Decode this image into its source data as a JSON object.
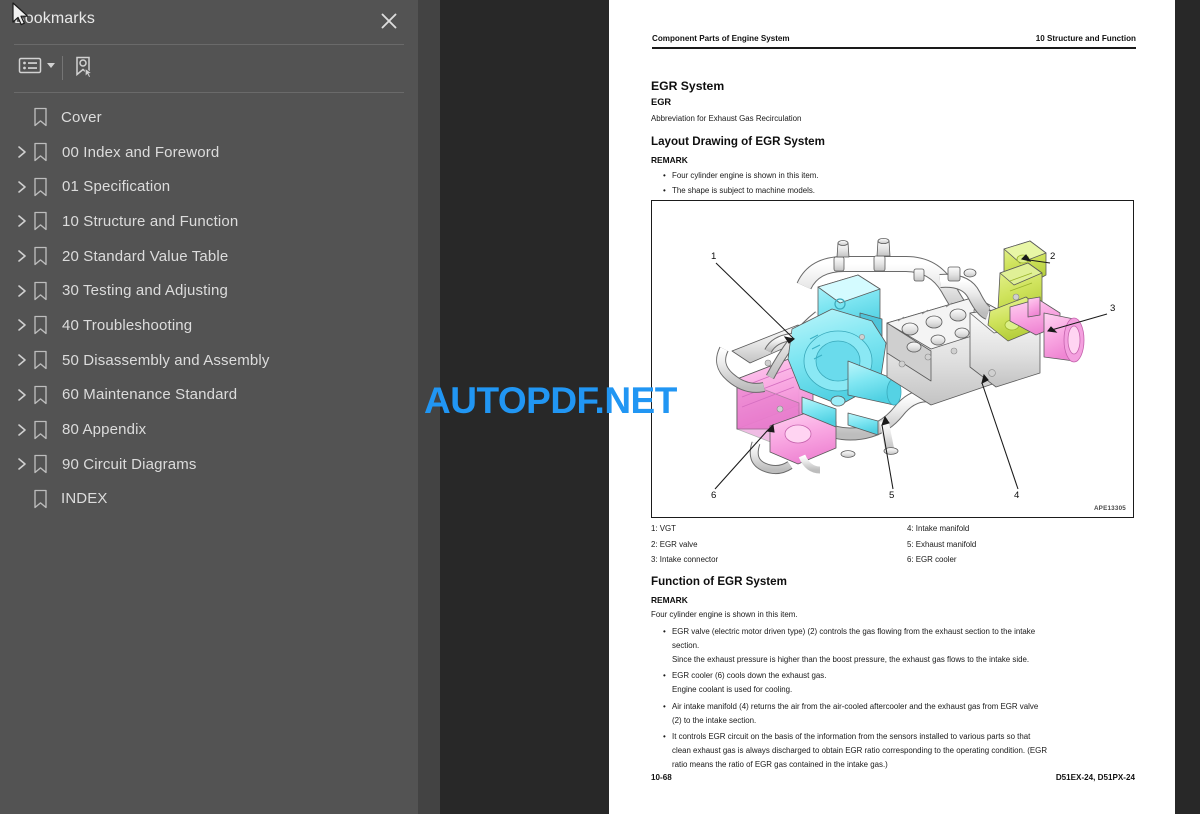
{
  "sidebar": {
    "title": "Bookmarks",
    "close_icon": "close-icon",
    "toolbar": {
      "options_label": "bookmark-options",
      "options_icon": "list-options-icon",
      "find_icon": "find-current-bookmark-icon"
    },
    "items": [
      {
        "label": "Cover",
        "expandable": false
      },
      {
        "label": "00 Index and Foreword",
        "expandable": true
      },
      {
        "label": "01 Specification",
        "expandable": true
      },
      {
        "label": "10 Structure and Function",
        "expandable": true
      },
      {
        "label": "20 Standard Value Table",
        "expandable": true
      },
      {
        "label": "30 Testing and Adjusting",
        "expandable": true
      },
      {
        "label": "40 Troubleshooting",
        "expandable": true
      },
      {
        "label": "50 Disassembly and Assembly",
        "expandable": true
      },
      {
        "label": "60 Maintenance Standard",
        "expandable": true
      },
      {
        "label": "80 Appendix",
        "expandable": true
      },
      {
        "label": "90 Circuit Diagrams",
        "expandable": true
      },
      {
        "label": "INDEX",
        "expandable": false
      }
    ]
  },
  "watermark": {
    "text": "AUTOPDF.NET",
    "color": "#2196F3"
  },
  "document": {
    "header": {
      "left": "Component Parts of Engine System",
      "right": "10 Structure and Function"
    },
    "footer": {
      "page_number": "10-68",
      "model": "D51EX-24, D51PX-24"
    },
    "section_title": "EGR System",
    "abbrev_title": "EGR",
    "abbrev_text": "Abbreviation for Exhaust Gas Recirculation",
    "layout_heading": "Layout Drawing of EGR System",
    "layout_remark_label": "REMARK",
    "layout_remarks": [
      "Four cylinder engine is shown in this item.",
      "The shape is subject to machine models."
    ],
    "figure": {
      "code": "APE13305",
      "callouts": [
        "1",
        "2",
        "3",
        "4",
        "5",
        "6"
      ]
    },
    "parts_left": [
      "1: VGT",
      "2: EGR valve",
      "3: Intake connector"
    ],
    "parts_right": [
      "4: Intake manifold",
      "5: Exhaust manifold",
      "6: EGR cooler"
    ],
    "function_heading": "Function of EGR System",
    "function_remark_label": "REMARK",
    "function_remark_text": "Four cylinder engine is shown in this item.",
    "function_bullets": [
      [
        "EGR valve (electric motor driven type) (2) controls the gas flowing from the exhaust section to the intake",
        "section.",
        "Since the exhaust pressure is higher than the boost pressure, the exhaust gas flows to the intake side."
      ],
      [
        "EGR cooler (6) cools down the exhaust gas.",
        "Engine coolant is used for cooling."
      ],
      [
        "Air intake manifold (4) returns the air from the air-cooled aftercooler and the exhaust gas from EGR valve",
        "(2) to the intake section."
      ],
      [
        "It controls EGR circuit on the basis of the information from the sensors installed to various parts so that",
        "clean exhaust gas is always discharged to obtain EGR ratio corresponding to the operating condition. (EGR",
        "ratio means the ratio of EGR gas contained in the intake gas.)"
      ]
    ]
  }
}
